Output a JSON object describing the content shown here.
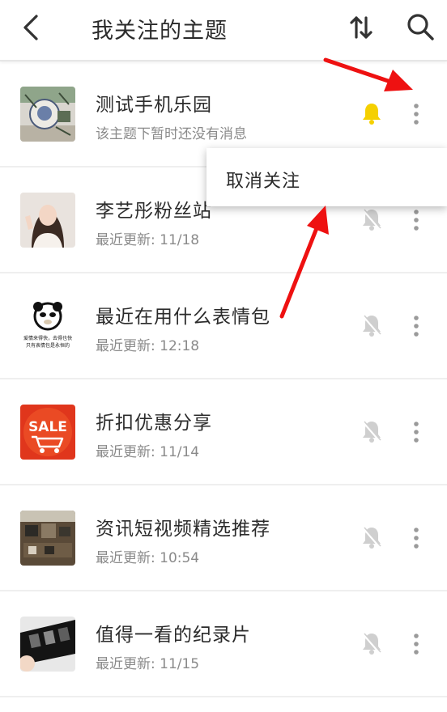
{
  "header": {
    "title": "我关注的主题",
    "back_icon": "chevron-left-icon",
    "sort_icon": "sort-arrows-icon",
    "search_icon": "search-icon"
  },
  "topics": [
    {
      "name": "测试手机乐园",
      "subtitle": "该主题下暂时还没有消息",
      "bell": "active"
    },
    {
      "name": "李艺彤粉丝站",
      "subtitle": "最近更新: 11/18",
      "bell": "muted"
    },
    {
      "name": "最近在用什么表情包",
      "subtitle": "最近更新: 12:18",
      "bell": "muted"
    },
    {
      "name": "折扣优惠分享",
      "subtitle": "最近更新: 11/14",
      "bell": "muted"
    },
    {
      "name": "资讯短视频精选推荐",
      "subtitle": "最近更新: 10:54",
      "bell": "muted"
    },
    {
      "name": "值得一看的纪录片",
      "subtitle": "最近更新: 11/15",
      "bell": "muted"
    }
  ],
  "thumbnails": {
    "meme_caption_1": "爱情来得快，去得也快",
    "meme_caption_2": "只有表情包是永恒的",
    "sale_label": "SALE"
  },
  "popup": {
    "unfollow_label": "取消关注"
  },
  "colors": {
    "bell_active": "#f5d000",
    "bell_muted": "#cfcfcf",
    "annotation_arrow": "#ee1111"
  }
}
